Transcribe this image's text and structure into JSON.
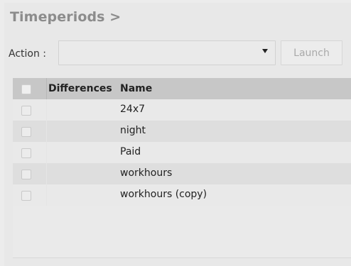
{
  "header": {
    "title": "Timeperiods >"
  },
  "toolbar": {
    "action_label": "Action :",
    "action_value": "",
    "launch_label": "Launch"
  },
  "table": {
    "columns": [
      "Differences",
      "Name"
    ],
    "rows": [
      {
        "name": "24x7"
      },
      {
        "name": "night"
      },
      {
        "name": "Paid"
      },
      {
        "name": "workhours"
      },
      {
        "name": "workhours (copy)"
      }
    ]
  },
  "colors": {
    "header_bg": "#c7c7c7",
    "row_odd": "#e9e9e9",
    "row_even": "#dedede",
    "title": "#8c8c8c"
  }
}
